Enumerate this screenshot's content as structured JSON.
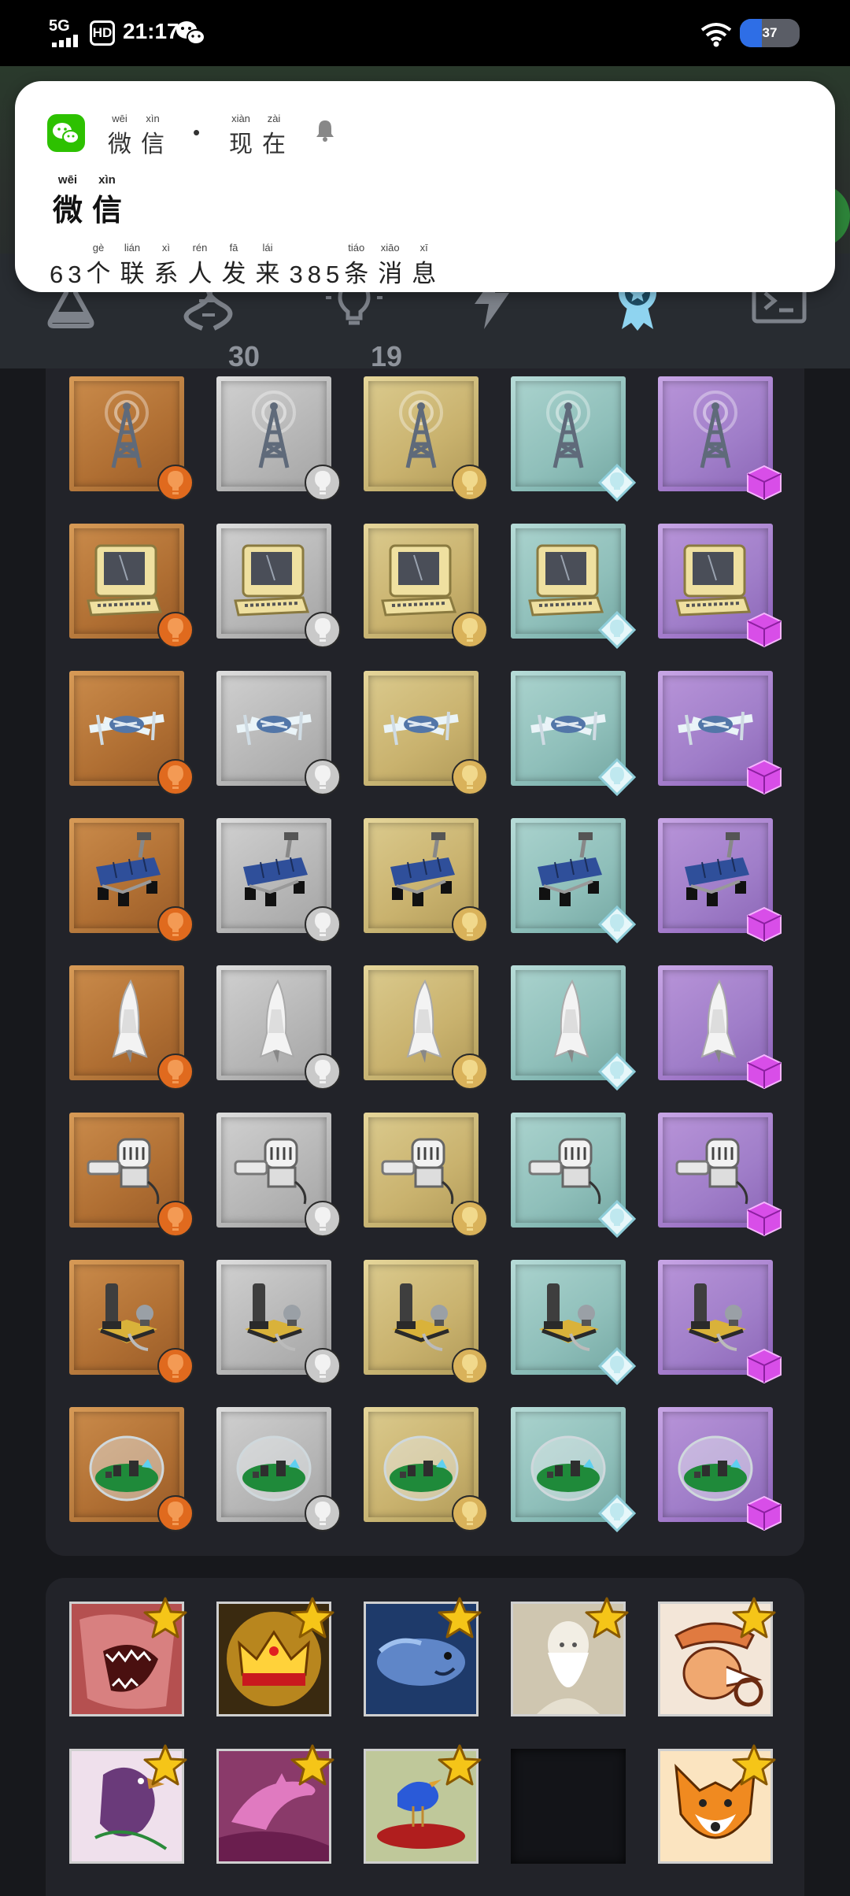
{
  "status_bar": {
    "network": "5G",
    "hd": "HD",
    "time": "21:17",
    "battery": "37",
    "battery_level_percent": 37
  },
  "notification": {
    "app_name": [
      {
        "char": "微",
        "py": "wēi"
      },
      {
        "char": "信",
        "py": "xìn"
      }
    ],
    "time": [
      {
        "char": "现",
        "py": "xiàn"
      },
      {
        "char": "在",
        "py": "zài"
      }
    ],
    "title": [
      {
        "char": "微",
        "py": "wēi"
      },
      {
        "char": "信",
        "py": "xìn"
      }
    ],
    "body_prefix": "63",
    "body_mid": [
      {
        "char": "个",
        "py": "gè"
      },
      {
        "char": "联",
        "py": "lián"
      },
      {
        "char": "系",
        "py": "xì"
      },
      {
        "char": "人",
        "py": "rén"
      },
      {
        "char": "发",
        "py": "fā"
      },
      {
        "char": "来",
        "py": "lái"
      }
    ],
    "body_count": "385",
    "body_end": [
      {
        "char": "条",
        "py": "tiáo"
      },
      {
        "char": "消",
        "py": "xiāo"
      },
      {
        "char": "息",
        "py": "xī"
      }
    ]
  },
  "tabs": [
    {
      "icon": "flask-icon",
      "count": ""
    },
    {
      "icon": "dna-icon",
      "count": "30"
    },
    {
      "icon": "lightbulb-icon",
      "count": "19"
    },
    {
      "icon": "lightning-icon",
      "count": ""
    },
    {
      "icon": "award-ribbon-icon",
      "count": "",
      "active": true
    },
    {
      "icon": "terminal-icon",
      "count": ""
    }
  ],
  "tiers": [
    "bronze",
    "silver",
    "gold",
    "diamond",
    "amethyst"
  ],
  "items": [
    "radio-tower",
    "computer",
    "drone",
    "rover",
    "space-shuttle",
    "robot",
    "telescope-station",
    "biodome"
  ],
  "achievements": [
    {
      "name": "shark-card",
      "starred": true
    },
    {
      "name": "crown-card",
      "starred": true
    },
    {
      "name": "fish-card",
      "starred": true
    },
    {
      "name": "darwin-card",
      "starred": true
    },
    {
      "name": "explorer-card",
      "starred": true
    },
    {
      "name": "bird-card",
      "starred": true
    },
    {
      "name": "dolphin-card",
      "starred": true
    },
    {
      "name": "duck-card",
      "starred": true
    },
    {
      "name": "empty-slot",
      "starred": false
    },
    {
      "name": "fox-card",
      "starred": true
    }
  ],
  "colors": {
    "background": "#17181c",
    "panel": "#222329",
    "wechat_green": "#2dc100",
    "active_tab": "#8fd4f0",
    "inactive_tab": "#8e939b",
    "bronze_badge": "#e06a1e",
    "silver_badge": "#c9c9c9",
    "gold_badge": "#d9b25a",
    "diamond_badge": "#bfe8ef",
    "amethyst_badge": "#d84ee8",
    "star": "#f5c518"
  }
}
